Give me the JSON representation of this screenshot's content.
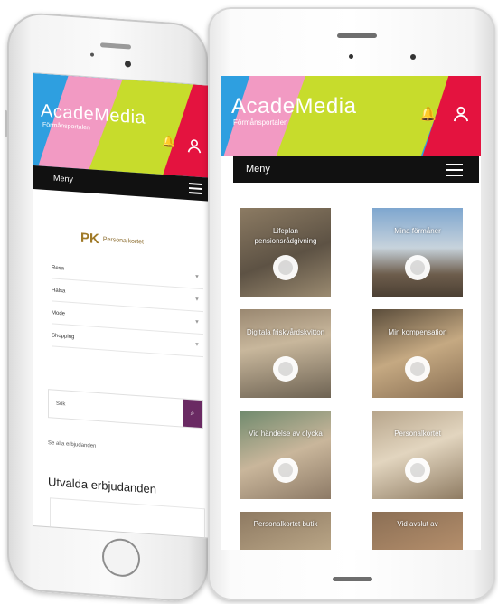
{
  "brand": {
    "logo": "AcadeMedia",
    "subtitle": "Förmånsportalen",
    "colors": {
      "blue": "#2e9fe0",
      "pink": "#f29ac3",
      "lime": "#c7dc2c",
      "red": "#e4133f",
      "menu": "#111111",
      "search": "#6a2a63"
    }
  },
  "left": {
    "menu_label": "Meny",
    "personalkortet": "Personalkortet",
    "categories": [
      "Resa",
      "Hälsa",
      "Mode",
      "Shopping"
    ],
    "search_placeholder": "Sök",
    "all_offers_link": "Se alla erbjudanden",
    "featured_heading": "Utvalda erbjudanden"
  },
  "right": {
    "menu_label": "Meny",
    "tiles": [
      {
        "label": "Lifeplan pensionsrådgivning",
        "icon": "map-icon"
      },
      {
        "label": "Mina förmåner",
        "icon": "award-icon"
      },
      {
        "label": "Digitala friskvårdskvitton",
        "icon": "upload-icon"
      },
      {
        "label": "Min kompensation",
        "icon": "pie-chart-icon"
      },
      {
        "label": "Vid händelse av olycka",
        "icon": "umbrella-icon"
      },
      {
        "label": "Personalkortet",
        "icon": "tag-icon"
      },
      {
        "label": "Personalkortet butik",
        "icon": "cart-icon"
      },
      {
        "label": "Vid avslut av",
        "icon": "door-icon"
      }
    ]
  }
}
